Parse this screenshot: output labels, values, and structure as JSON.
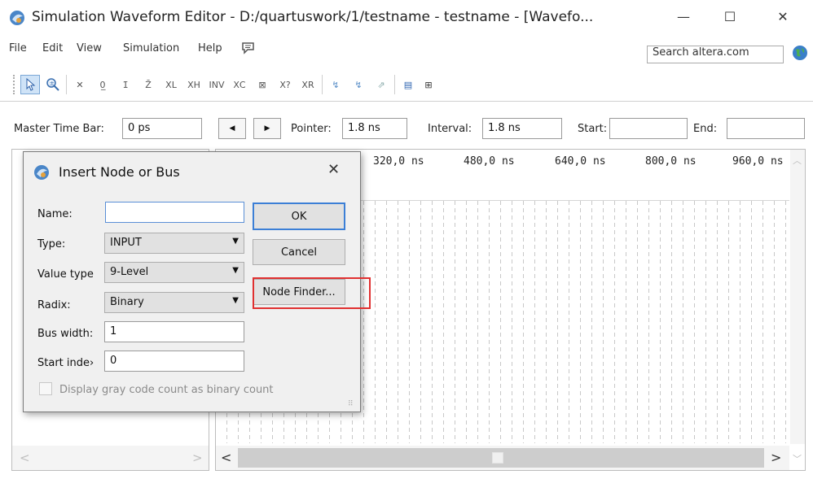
{
  "window": {
    "title": "Simulation Waveform Editor - D:/quartuswork/1/testname - testname - [Wavefo...",
    "minimize": "—",
    "maximize": "☐",
    "close": "✕"
  },
  "menu": {
    "items": [
      "File",
      "Edit",
      "View",
      "Simulation",
      "Help"
    ],
    "search_value": "Search altera.com"
  },
  "toolbar": {
    "icons": [
      "pointer-tool-icon",
      "zoom-tool-icon",
      "forcing-unknown-icon",
      "forcing-low-icon",
      "forcing-high-icon",
      "high-impedance-icon",
      "weak-low-icon",
      "weak-high-icon",
      "invert-icon",
      "count-value-icon",
      "clock-icon",
      "arbitrary-value-icon",
      "random-value-icon",
      "snap-to-grid-icon",
      "run-functional-sim-icon",
      "run-timing-sim-icon",
      "generate-netlist-icon",
      "node-finder-icon"
    ]
  },
  "timebar": {
    "master_label": "Master Time Bar:",
    "master_value": "0 ps",
    "pointer_label": "Pointer:",
    "pointer_value": "1.8 ns",
    "interval_label": "Interval:",
    "interval_value": "1.8 ns",
    "start_label": "Start:",
    "start_value": "",
    "end_label": "End:",
    "end_value": ""
  },
  "waveform": {
    "ticks": [
      "320,0 ns",
      "480,0 ns",
      "640,0 ns",
      "800,0 ns",
      "960,0 ns"
    ]
  },
  "dialog": {
    "title": "Insert Node or Bus",
    "close": "✕",
    "name_label": "Name:",
    "name_value": "",
    "type_label": "Type:",
    "type_value": "INPUT",
    "value_type_label": "Value type",
    "value_type_value": "9-Level",
    "radix_label": "Radix:",
    "radix_value": "Binary",
    "bus_width_label": "Bus width:",
    "bus_width_value": "1",
    "start_index_label": "Start inde›",
    "start_index_value": "0",
    "gray_code_label": "Display gray code count as binary count",
    "ok": "OK",
    "cancel": "Cancel",
    "node_finder": "Node Finder...",
    "highlight_color": "#e03030"
  }
}
